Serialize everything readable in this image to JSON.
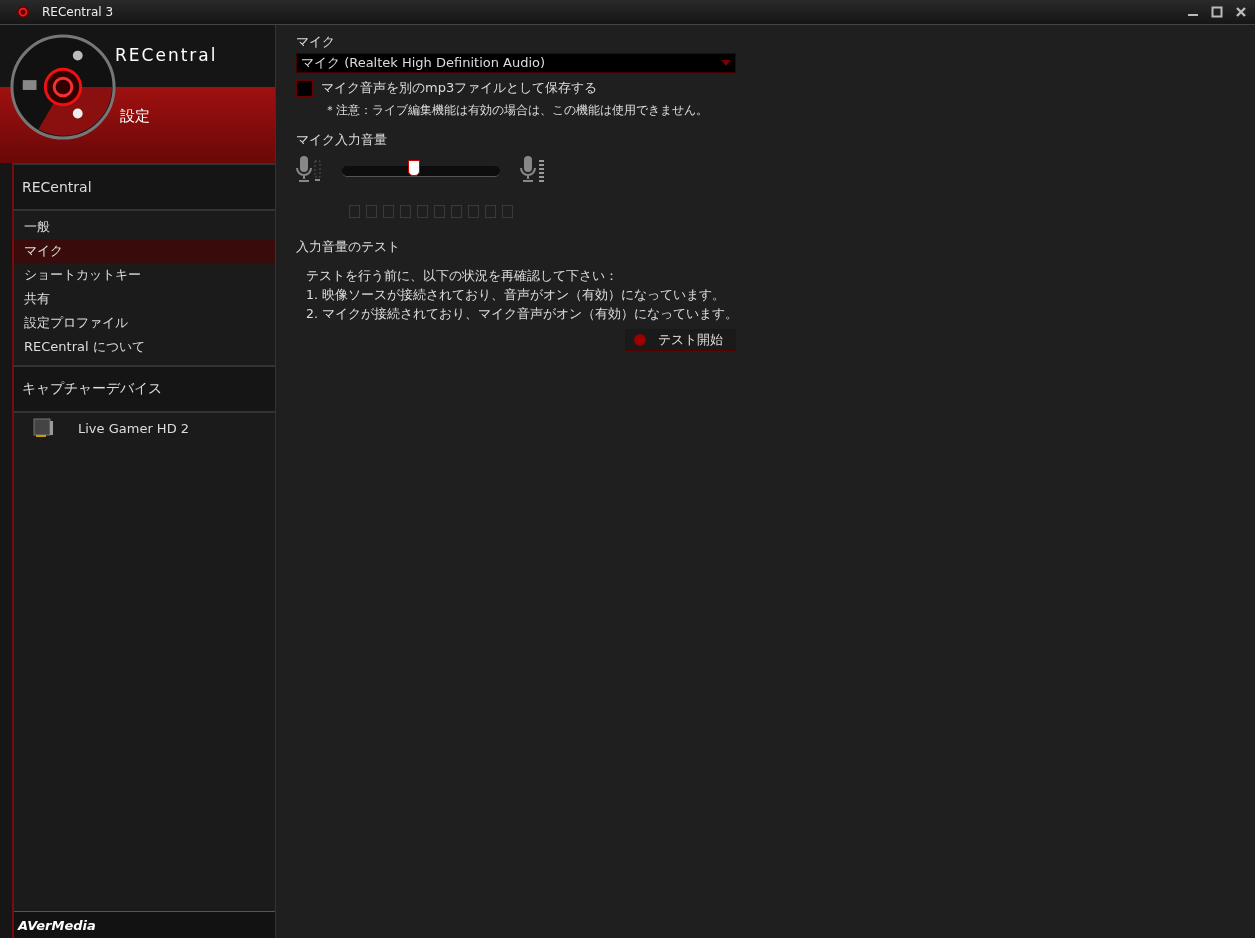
{
  "window": {
    "title": "RECentral 3"
  },
  "brand": {
    "logo": "RECentral",
    "section": "設定",
    "footer": "AVerMedia"
  },
  "sidebar": {
    "groups": [
      {
        "title": "RECentral",
        "items": [
          {
            "label": "一般",
            "selected": false
          },
          {
            "label": "マイク",
            "selected": true
          },
          {
            "label": "ショートカットキー",
            "selected": false
          },
          {
            "label": "共有",
            "selected": false
          },
          {
            "label": "設定プロファイル",
            "selected": false
          },
          {
            "label": "RECentral について",
            "selected": false
          }
        ]
      },
      {
        "title": "キャプチャーデバイス",
        "devices": [
          {
            "label": "Live Gamer HD 2"
          }
        ]
      }
    ]
  },
  "mic": {
    "label": "マイク",
    "device": "マイク (Realtek High Definition Audio)",
    "save_mp3": {
      "label": "マイク音声を別のmp3ファイルとして保存する",
      "checked": false
    },
    "note": "＊注意：ライブ編集機能は有効の場合は、この機能は使用できません。"
  },
  "volume": {
    "label": "マイク入力音量",
    "level": 0.45
  },
  "test": {
    "title": "入力音量のテスト",
    "lines": [
      "テストを行う前に、以下の状況を再確認して下さい：",
      "1. 映像ソースが接続されており、音声がオン（有効）になっています。",
      "2. マイクが接続されており、マイク音声がオン（有効）になっています。"
    ],
    "button": "テスト開始"
  }
}
